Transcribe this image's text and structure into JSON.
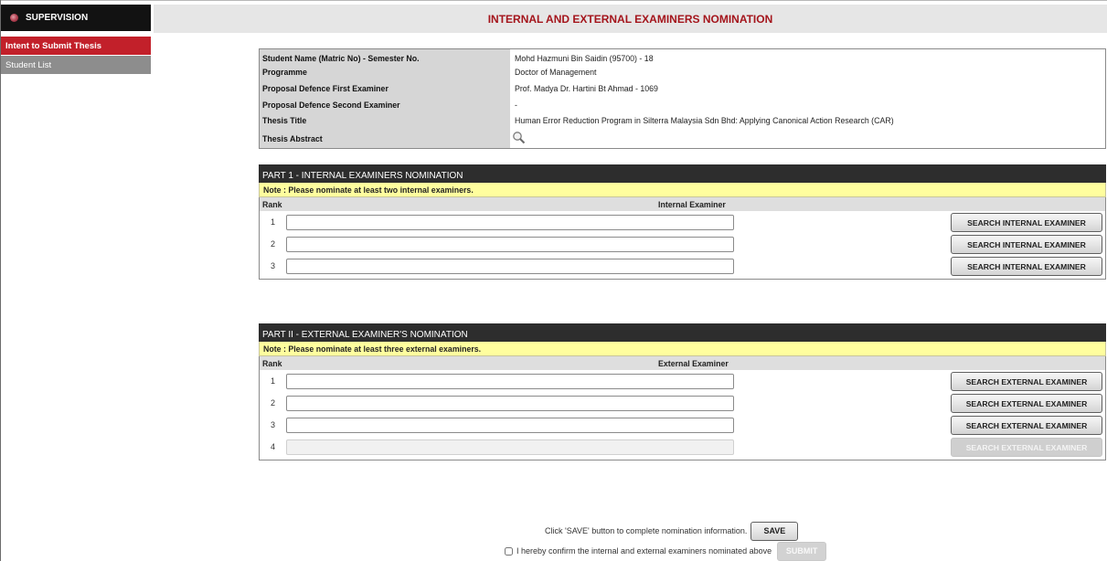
{
  "sidebar": {
    "header": "SUPERVISION",
    "items": [
      {
        "label": "Intent to Submit Thesis"
      },
      {
        "label": "Student List"
      }
    ]
  },
  "page": {
    "title": "INTERNAL AND EXTERNAL EXAMINERS NOMINATION"
  },
  "info": [
    {
      "label": "Student Name (Matric No) - Semester No.",
      "value": "Mohd Hazmuni Bin Saidin (95700)  - 18"
    },
    {
      "label": "Programme",
      "value": "Doctor of Management"
    },
    {
      "label": "Proposal Defence First Examiner",
      "value": "Prof. Madya Dr. Hartini Bt Ahmad  - 1069"
    },
    {
      "label": "Proposal Defence Second Examiner",
      "value": "-"
    },
    {
      "label": "Thesis Title",
      "value": "Human Error Reduction Program in Silterra Malaysia Sdn Bhd: Applying Canonical Action Research (CAR)"
    },
    {
      "label": "Thesis Abstract",
      "icon": "magnify-icon"
    }
  ],
  "internal": {
    "title": "PART 1 - INTERNAL EXAMINERS NOMINATION",
    "note": "Note : Please nominate at least two internal examiners.",
    "col_rank": "Rank",
    "col_examiner": "Internal Examiner",
    "rows": [
      {
        "rank": "1",
        "value": "",
        "button": "SEARCH INTERNAL EXAMINER"
      },
      {
        "rank": "2",
        "value": "",
        "button": "SEARCH INTERNAL EXAMINER"
      },
      {
        "rank": "3",
        "value": "",
        "button": "SEARCH INTERNAL EXAMINER"
      }
    ]
  },
  "external": {
    "title": "PART II - EXTERNAL EXAMINER'S NOMINATION",
    "note": "Note : Please nominate at least three external examiners.",
    "col_rank": "Rank",
    "col_examiner": "External Examiner",
    "rows": [
      {
        "rank": "1",
        "value": "",
        "button": "SEARCH EXTERNAL EXAMINER",
        "disabled": false
      },
      {
        "rank": "2",
        "value": "",
        "button": "SEARCH EXTERNAL EXAMINER",
        "disabled": false
      },
      {
        "rank": "3",
        "value": "",
        "button": "SEARCH EXTERNAL EXAMINER",
        "disabled": false
      },
      {
        "rank": "4",
        "value": "",
        "button": "SEARCH EXTERNAL EXAMINER",
        "disabled": true
      }
    ]
  },
  "save": {
    "text": "Click 'SAVE' button to complete nomination information.",
    "button": "SAVE"
  },
  "confirm": {
    "text": "I hereby confirm the internal and external examiners nominated above",
    "checked": false,
    "button": "SUBMIT"
  }
}
